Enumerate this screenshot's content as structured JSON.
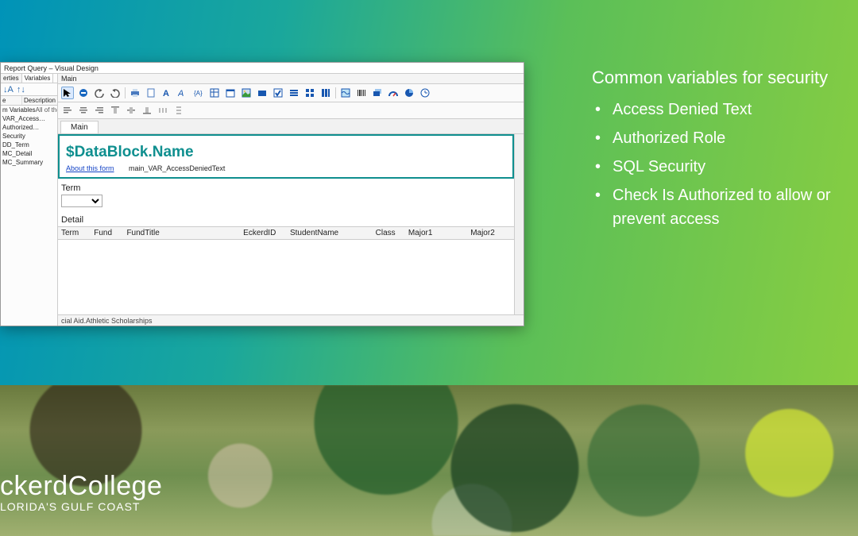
{
  "slide": {
    "heading": "Common variables for security",
    "bullets": [
      "Access Denied Text",
      "Authorized Role",
      "SQL Security",
      "Check Is Authorized to allow or prevent access"
    ]
  },
  "logo": {
    "main": "ckerdCollege",
    "sub": "LORIDA'S GULF COAST"
  },
  "app": {
    "title": "Report Query – Visual Design",
    "side_tabs": {
      "left": "erties",
      "right": "Variables"
    },
    "side_head": {
      "name": "e",
      "desc": "Description"
    },
    "tree_top": {
      "name": "m Variables",
      "desc": "All of the a"
    },
    "tree": [
      "VAR_Access…",
      "Authorized…",
      "Security",
      "DD_Term",
      "MC_Detail",
      "MC_Summary"
    ],
    "main_label": "Main",
    "doc_tab": "Main",
    "band_heading": "$DataBlock.Name",
    "about_link": "About this form",
    "about_value": "main_VAR_AccessDeniedText",
    "section_term": "Term",
    "section_detail": "Detail",
    "columns": {
      "term": "Term",
      "fund": "Fund",
      "fundTitle": "FundTitle",
      "eckerdId": "EckerdID",
      "studentName": "StudentName",
      "class": "Class",
      "major1": "Major1",
      "major2": "Major2"
    },
    "status": "cial Aid.Athletic Scholarships"
  }
}
